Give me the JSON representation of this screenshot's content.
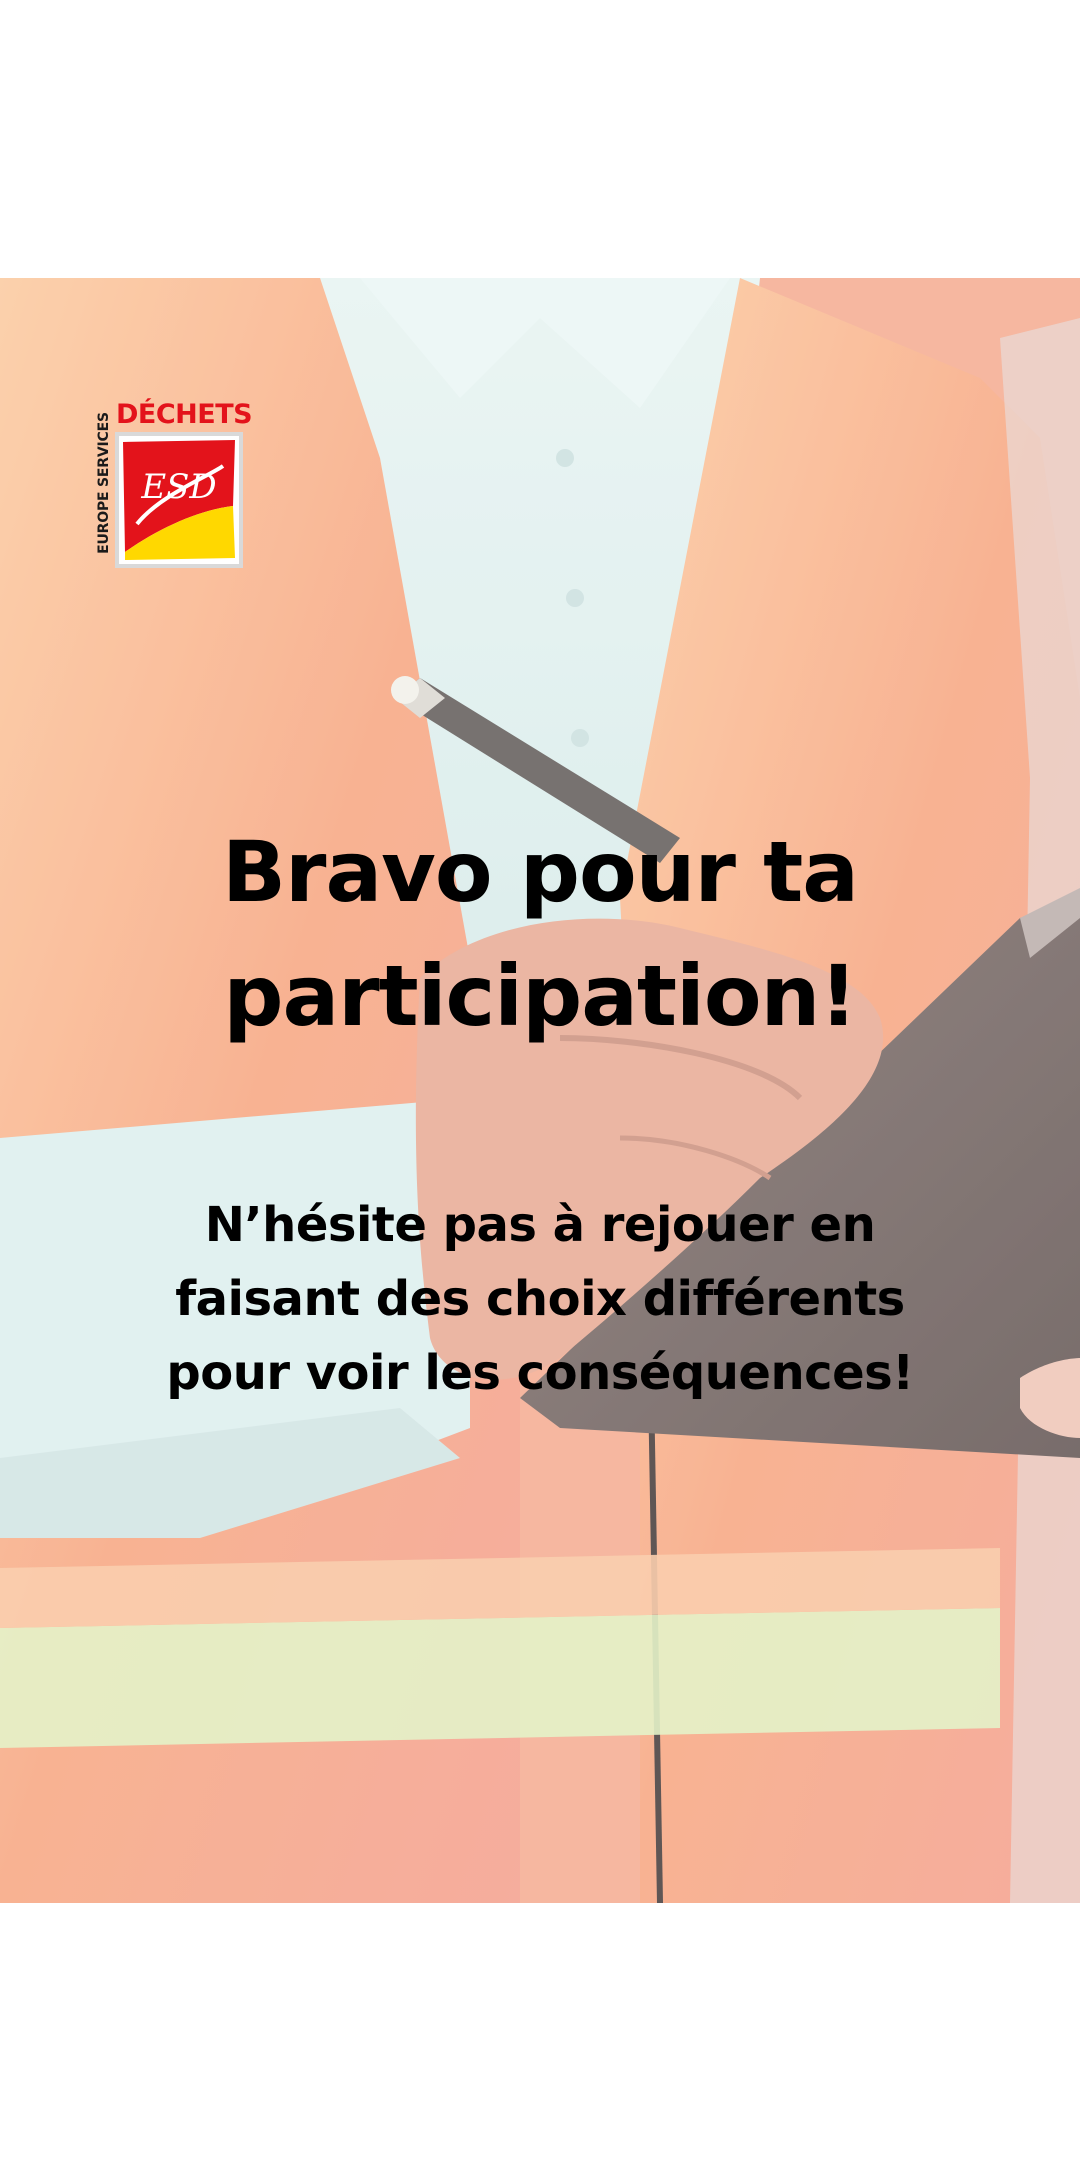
{
  "logo": {
    "brand_vertical": "EUROPE SERVICES",
    "brand_word": "DÉCHETS",
    "mark_letters": "ESD",
    "colors": {
      "red": "#e3131b",
      "yellow": "#ffd800",
      "frame": "#d9d9d9"
    }
  },
  "message": {
    "title_line1": "Bravo pour ta",
    "title_line2": "participation!",
    "body_line1": "N’hésite pas à rejouer en",
    "body_line2": "faisant des choix différents",
    "body_line3": "pour voir les conséquences!"
  },
  "background": {
    "subject": "worker-in-orange-safety-vest-writing-on-clipboard",
    "colors": {
      "vest": "#f6a57e",
      "shirt": "#dcefee",
      "stripe": "#d9ecb7",
      "clipboard": "#6b5b58"
    }
  }
}
